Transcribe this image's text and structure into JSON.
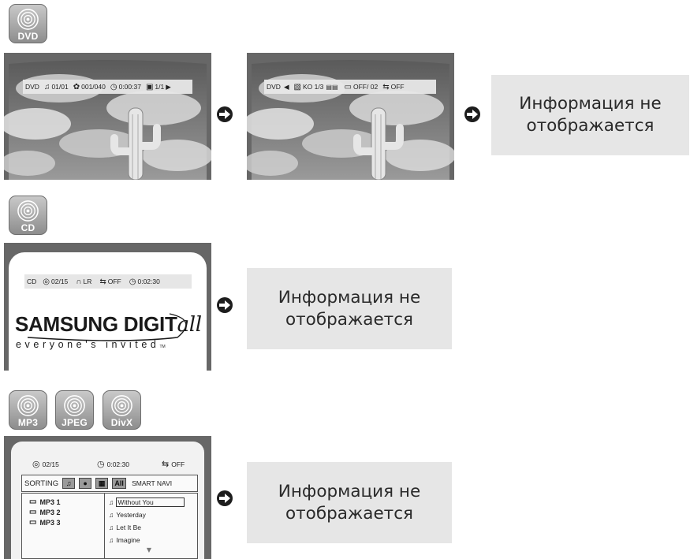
{
  "dvd": {
    "badge": "DVD",
    "icon": "disc-icon",
    "screen1_osd": {
      "mode": "DVD",
      "title": "01/01",
      "chapter": "001/040",
      "time": "0:00:37",
      "angle": "1/1"
    },
    "screen2_osd": {
      "mode": "DVD",
      "audio": "KO 1/3",
      "subtitle": "OFF/ 02",
      "repeat": "OFF"
    },
    "info_line1": "Информация не",
    "info_line2": "отображается"
  },
  "cd": {
    "badge": "CD",
    "osd": {
      "mode": "CD",
      "track": "02/15",
      "channel": "LR",
      "repeat": "OFF",
      "time": "0:02:30"
    },
    "logo_text": "SAMSUNG DIGIT",
    "logo_all": "all",
    "tagline": "everyone's invited",
    "tm": "TM",
    "info_line1": "Информация не",
    "info_line2": "отображается"
  },
  "media": {
    "badges": [
      "MP3",
      "JPEG",
      "DivX"
    ],
    "top": {
      "track": "02/15",
      "time": "0:02:30",
      "repeat": "OFF"
    },
    "sorting_label": "SORTING",
    "all_label": "All",
    "smart_navi": "SMART NAVI",
    "folders": [
      "MP3 1",
      "MP3 2",
      "MP3 3"
    ],
    "songs": [
      "Without You",
      "Yesterday",
      "Let It Be",
      "Imagine"
    ],
    "info_line1": "Информация не",
    "info_line2": "отображается"
  },
  "colors": {
    "badge": "#a8a8a8",
    "info_box": "#e6e6e6",
    "tv_frame": "#676767",
    "arrow": "#1d1d1d"
  }
}
